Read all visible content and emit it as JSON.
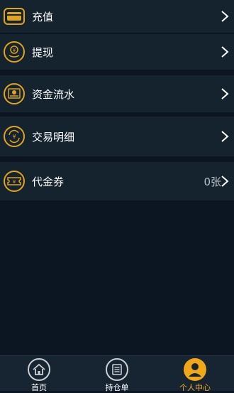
{
  "menu": [
    {
      "label": "充值",
      "icon": "card-icon"
    },
    {
      "label": "提现",
      "icon": "withdraw-icon"
    },
    {
      "label": "资金流水",
      "icon": "ledger-icon"
    },
    {
      "label": "交易明细",
      "icon": "exchange-icon"
    },
    {
      "label": "代金券",
      "icon": "voucher-icon",
      "value": "0张"
    }
  ],
  "tabbar": {
    "tabs": [
      {
        "label": "首页",
        "icon": "home-icon"
      },
      {
        "label": "持仓单",
        "icon": "list-icon"
      },
      {
        "label": "个人中心",
        "icon": "user-icon",
        "active": true
      }
    ]
  },
  "colors": {
    "accent": "#e0a31e",
    "background": "#0b1622",
    "row": "#15232f",
    "active_tab": "#f0a818"
  }
}
